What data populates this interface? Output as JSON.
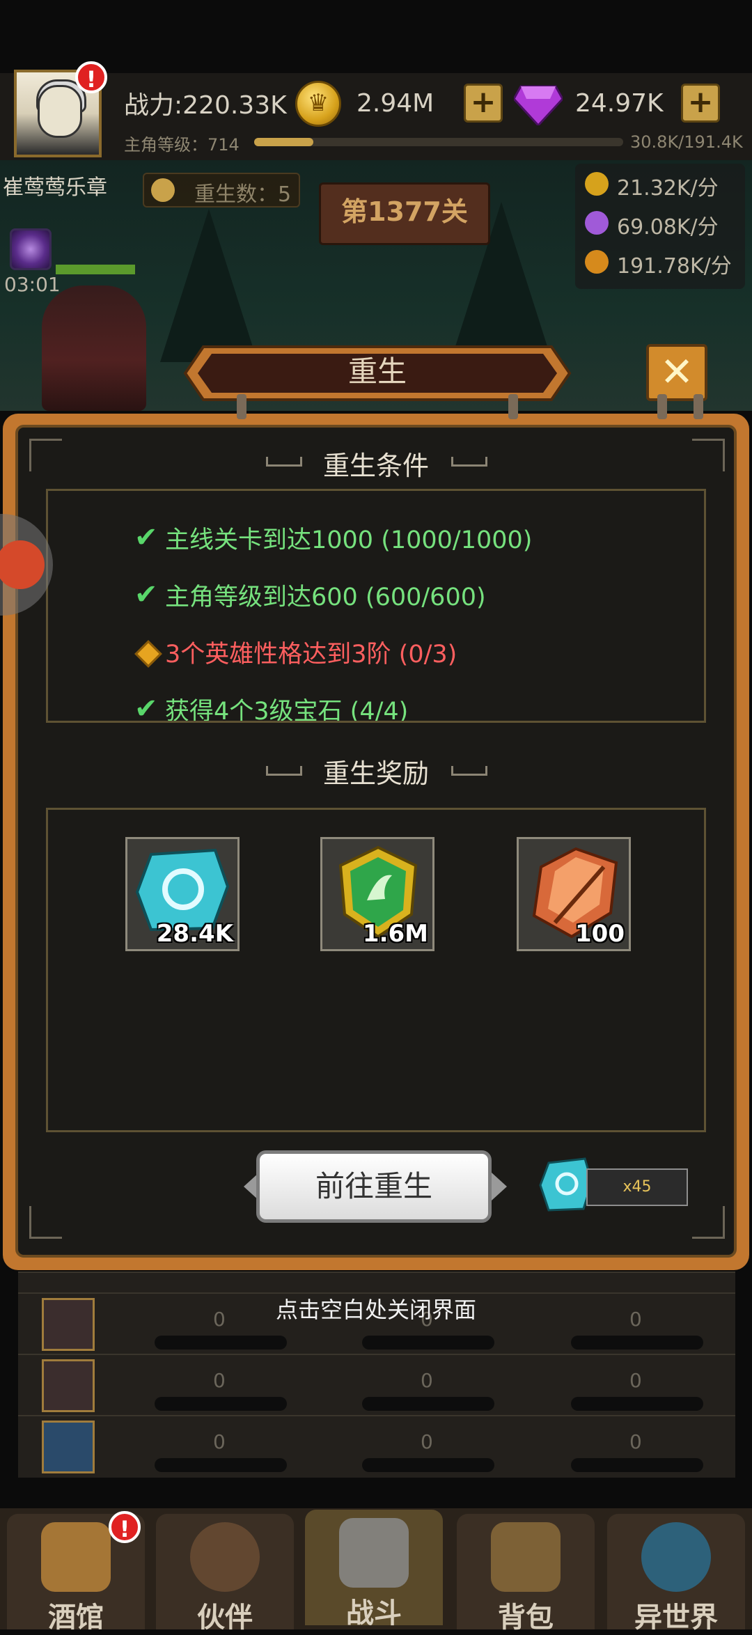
{
  "hud": {
    "power_label": "战力:220.33K",
    "level_label": "主角等级：714",
    "level_progress_text": "30.8K/191.4K",
    "level_progress": 0.16,
    "gold": "2.94M",
    "gems": "24.97K",
    "gold_icon_glyph": "♛",
    "plus_glyph": "+",
    "alert_glyph": "!"
  },
  "scene": {
    "chapter_name": "崔莺莺乐章",
    "rebirth_count": "重生数：5",
    "stage": "第1377关",
    "timer": "03:01",
    "rates": [
      {
        "icon": "gold-coin-icon",
        "value": "21.32K/分",
        "color": "#d6a21c"
      },
      {
        "icon": "exp-icon",
        "value": "69.08K/分",
        "color": "#a05ad8"
      },
      {
        "icon": "gold-pot-icon",
        "value": "191.78K/分",
        "color": "#d68a1c"
      }
    ]
  },
  "modal": {
    "title": "重生",
    "close_glyph": "✕",
    "conditions_title": "重生条件",
    "conditions": [
      {
        "text": "主线关卡到达1000 (1000/1000)",
        "met": true
      },
      {
        "text": "主角等级到达600 (600/600)",
        "met": true
      },
      {
        "text": "3个英雄性格达到3阶 (0/3)",
        "met": false
      },
      {
        "text": "获得4个3级宝石 (4/4)",
        "met": true
      }
    ],
    "check_glyph": "✔",
    "rewards_title": "重生奖励",
    "rewards": [
      {
        "icon": "blue-rune-stone-icon",
        "count": "28.4K"
      },
      {
        "icon": "green-emblem-icon",
        "count": "1.6M"
      },
      {
        "icon": "orange-crystal-icon",
        "count": "100"
      }
    ],
    "go_button": "前往重生",
    "cost": "x45"
  },
  "list": {
    "rows": [
      {
        "values": [
          "0",
          "0",
          "0"
        ]
      },
      {
        "values": [
          "0",
          "0",
          "0"
        ]
      },
      {
        "values": [
          "0",
          "0",
          "0"
        ]
      }
    ]
  },
  "hint": "点击空白处关闭界面",
  "nav": [
    {
      "label": "酒馆",
      "icon": "tavern-mug-icon",
      "active": false
    },
    {
      "label": "伙伴",
      "icon": "partner-icon",
      "active": false
    },
    {
      "label": "战斗",
      "icon": "crossed-swords-icon",
      "active": true
    },
    {
      "label": "背包",
      "icon": "backpack-icon",
      "active": false
    },
    {
      "label": "异世界",
      "icon": "portal-icon",
      "active": false
    }
  ]
}
